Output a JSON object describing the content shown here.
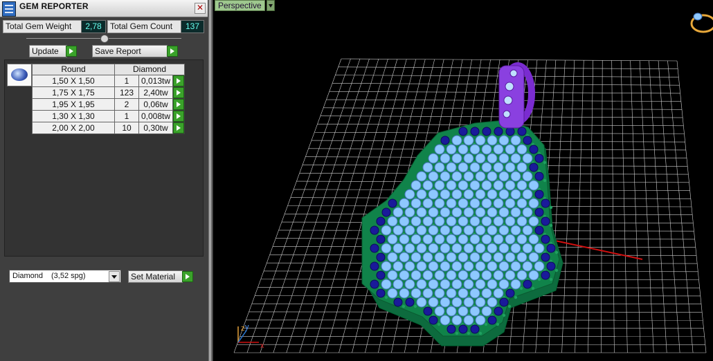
{
  "window": {
    "title": "GEM REPORTER"
  },
  "stats": {
    "weight_label": "Total Gem Weight",
    "weight_value": "2,78",
    "count_label": "Total Gem Count",
    "count_value": "137"
  },
  "buttons": {
    "update": "Update",
    "save_report": "Save Report",
    "set_material": "Set Material"
  },
  "table": {
    "headers": [
      "Round",
      "Diamond"
    ],
    "rows": [
      {
        "size": "1,50 X 1,50",
        "count": "1",
        "weight": "0,013tw"
      },
      {
        "size": "1,75 X 1,75",
        "count": "123",
        "weight": "2,40tw"
      },
      {
        "size": "1,95 X 1,95",
        "count": "2",
        "weight": "0,06tw"
      },
      {
        "size": "1,30 X 1,30",
        "count": "1",
        "weight": "0,008tw"
      },
      {
        "size": "2,00 X 2,00",
        "count": "10",
        "weight": "0,30tw"
      }
    ]
  },
  "material": {
    "name": "Diamond",
    "sg": "(3,52 spg)"
  },
  "viewport": {
    "label": "Perspective",
    "axes": {
      "x": "x",
      "y": "y",
      "z": "z"
    },
    "gizmo_icon": "ring-view-icon"
  },
  "colors": {
    "grid": "#d0d0d0",
    "x_axis": "#d01010",
    "metal": "#0f7a4a",
    "gem_blue": "#8ec8ff",
    "gem_navy": "#1a1a9a",
    "bail": "#8a40e0"
  }
}
